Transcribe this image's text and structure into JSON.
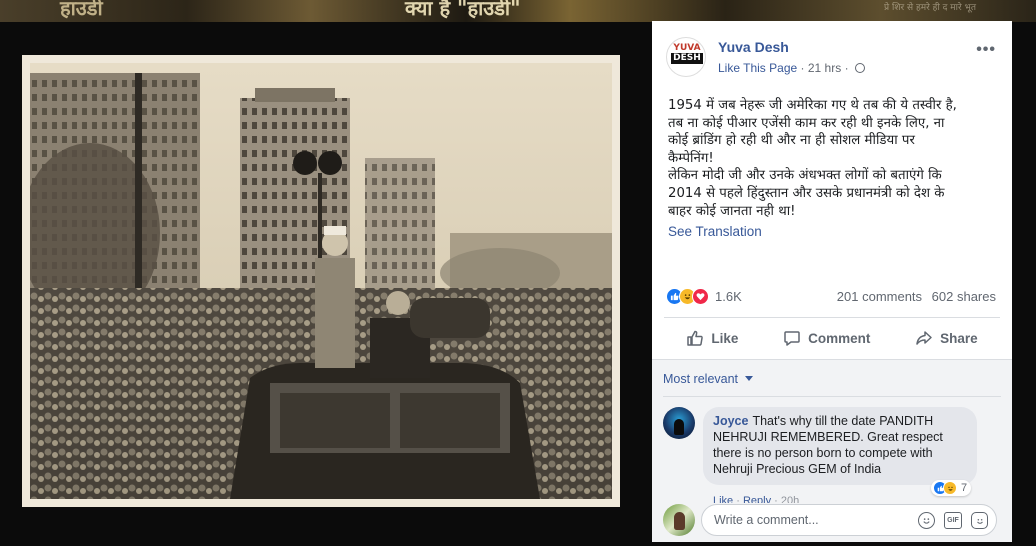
{
  "background": {
    "headline": "क्या है \"हाउडी\"",
    "left_fragment": "हाउडी",
    "corner_text": "प्रे शिर से हमरे ही द मारे भूत"
  },
  "photo": {
    "alt": "Archival black-and-white photograph of an open car in a crowded street"
  },
  "post": {
    "page_name": "Yuva Desh",
    "avatar_top": "YUVA",
    "avatar_bottom": "DESH",
    "like_page": "Like This Page",
    "separator": "·",
    "time": "21 hrs",
    "separator2": "·",
    "more": "•••",
    "text_lines": [
      "1954 में जब नेहरू जी अमेरिका गए थे तब की ये तस्वीर है,",
      "तब ना कोई पीआर एजेंसी काम कर रही थी इनके लिए, ना",
      "कोई ब्रांडिंग हो रही थी और ना ही सोशल मीडिया पर",
      "कैम्पेनिंग!",
      "लेकिन मोदी जी और उनके अंधभक्त लोगों को बताएंगे कि",
      "2014 से पहले हिंदुस्तान और उसके प्रधानमंत्री को देश के",
      "बाहर कोई जानता नही था!"
    ],
    "see_translation": "See Translation",
    "reaction_count": "1.6K",
    "comments_count": "201 comments",
    "shares_count": "602 shares"
  },
  "actions": {
    "like": "Like",
    "comment": "Comment",
    "share": "Share"
  },
  "comments": {
    "sort_label": "Most relevant",
    "items": [
      {
        "author": "Joyce",
        "text": "That's why till the date PANDITH NEHRUJI REMEMBERED. Great respect there is no person born to compete with Nehruji Precious GEM of India",
        "reaction_count": "7",
        "like_label": "Like",
        "reply_label": "Reply",
        "time": "20h"
      }
    ],
    "write_placeholder": "Write a comment...",
    "gif_label": "GIF"
  },
  "colors": {
    "link": "#385898",
    "like_blue": "#1877f2",
    "love_red": "#f02849",
    "haha_yellow": "#f7b928"
  }
}
